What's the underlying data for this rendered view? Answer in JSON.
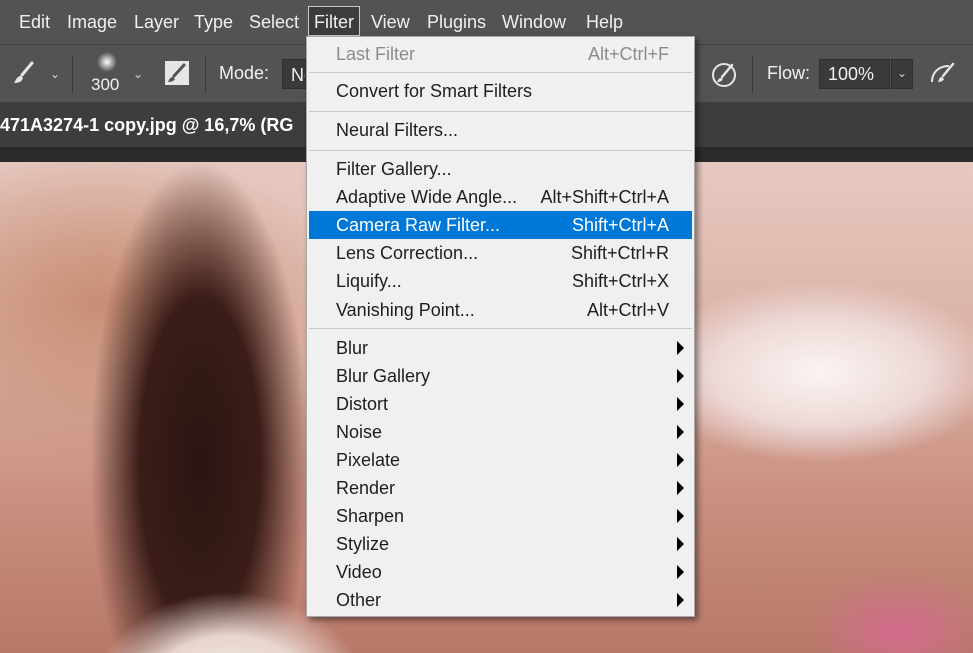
{
  "menubar": {
    "items": [
      "Edit",
      "Image",
      "Layer",
      "Type",
      "Select",
      "Filter",
      "View",
      "Plugins",
      "Window",
      "Help"
    ]
  },
  "options": {
    "brush_size": "300",
    "mode_label": "Mode:",
    "mode_value": "No",
    "flow_label": "Flow:",
    "flow_value": "100%"
  },
  "document": {
    "tab_title": "471A3274-1 copy.jpg @ 16,7% (RG"
  },
  "filter_menu": {
    "items": [
      {
        "label": "Last Filter",
        "shortcut": "Alt+Ctrl+F",
        "disabled": true
      },
      {
        "label": "Convert for Smart Filters",
        "shortcut": ""
      },
      {
        "label": "Neural Filters...",
        "shortcut": ""
      },
      {
        "label": "Filter Gallery...",
        "shortcut": ""
      },
      {
        "label": "Adaptive Wide Angle...",
        "shortcut": "Alt+Shift+Ctrl+A"
      },
      {
        "label": "Camera Raw Filter...",
        "shortcut": "Shift+Ctrl+A",
        "highlighted": true
      },
      {
        "label": "Lens Correction...",
        "shortcut": "Shift+Ctrl+R"
      },
      {
        "label": "Liquify...",
        "shortcut": "Shift+Ctrl+X"
      },
      {
        "label": "Vanishing Point...",
        "shortcut": "Alt+Ctrl+V"
      },
      {
        "label": "Blur",
        "submenu": true
      },
      {
        "label": "Blur Gallery",
        "submenu": true
      },
      {
        "label": "Distort",
        "submenu": true
      },
      {
        "label": "Noise",
        "submenu": true
      },
      {
        "label": "Pixelate",
        "submenu": true
      },
      {
        "label": "Render",
        "submenu": true
      },
      {
        "label": "Sharpen",
        "submenu": true
      },
      {
        "label": "Stylize",
        "submenu": true
      },
      {
        "label": "Video",
        "submenu": true
      },
      {
        "label": "Other",
        "submenu": true
      }
    ]
  },
  "colors": {
    "highlight": "#0078d7",
    "menubar_bg": "#535353",
    "menu_bg": "#f0f0f0"
  }
}
